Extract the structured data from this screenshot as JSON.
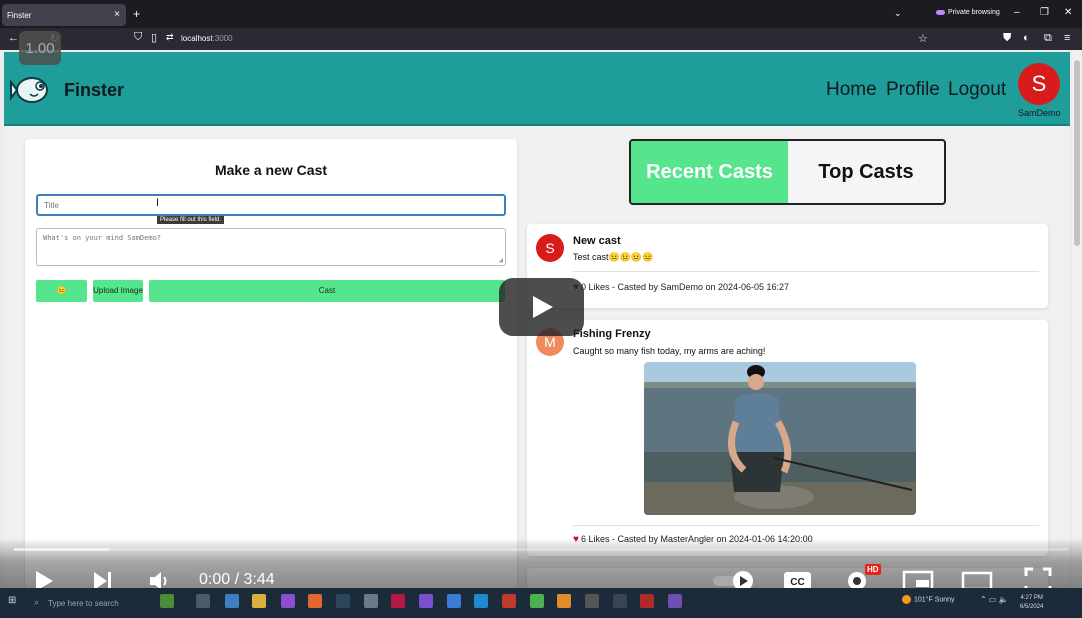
{
  "browser": {
    "tab_title": "Finster",
    "tab_close": "×",
    "new_tab": "+",
    "tab_list": "⌄",
    "private_label": "Private browsing",
    "url_host": "localhost",
    "url_port": ":3000"
  },
  "player": {
    "speed_badge": "1.00",
    "time": "0:00 / 3:44",
    "hd_badge": "HD",
    "progress_loaded": 0.09
  },
  "app": {
    "brand": "Finster",
    "nav": {
      "home": "Home",
      "profile": "Profile",
      "logout": "Logout"
    },
    "user": {
      "initial": "S",
      "name": "SamDemo"
    }
  },
  "composer": {
    "heading": "Make a new Cast",
    "title_placeholder": "Title",
    "body_placeholder": "What's on your mind SamDemo?",
    "validation_tooltip": "Please fill out this field.",
    "emoji_button": "😐",
    "upload_button": "Upload Image",
    "cast_button": "Cast"
  },
  "feed_toggle": {
    "recent": "Recent Casts",
    "top": "Top Casts",
    "active": "recent"
  },
  "casts": [
    {
      "initial": "S",
      "avatar_color": "#d81b1b",
      "title": "New cast",
      "body": "Test cast😐😐😐😐",
      "meta": "0 Likes - Casted by SamDemo on 2024-06-05 16:27"
    },
    {
      "initial": "M",
      "avatar_color": "#f08a5d",
      "title": "Fishing Frenzy",
      "body": "Caught so many fish today, my arms are aching!",
      "meta": "6 Likes - Casted by MasterAngler on 2024-01-06 14:20:00"
    }
  ],
  "taskbar": {
    "search_placeholder": "Type here to search",
    "weather": "101°F  Sunny",
    "time": "4:27 PM",
    "date": "6/5/2024"
  }
}
